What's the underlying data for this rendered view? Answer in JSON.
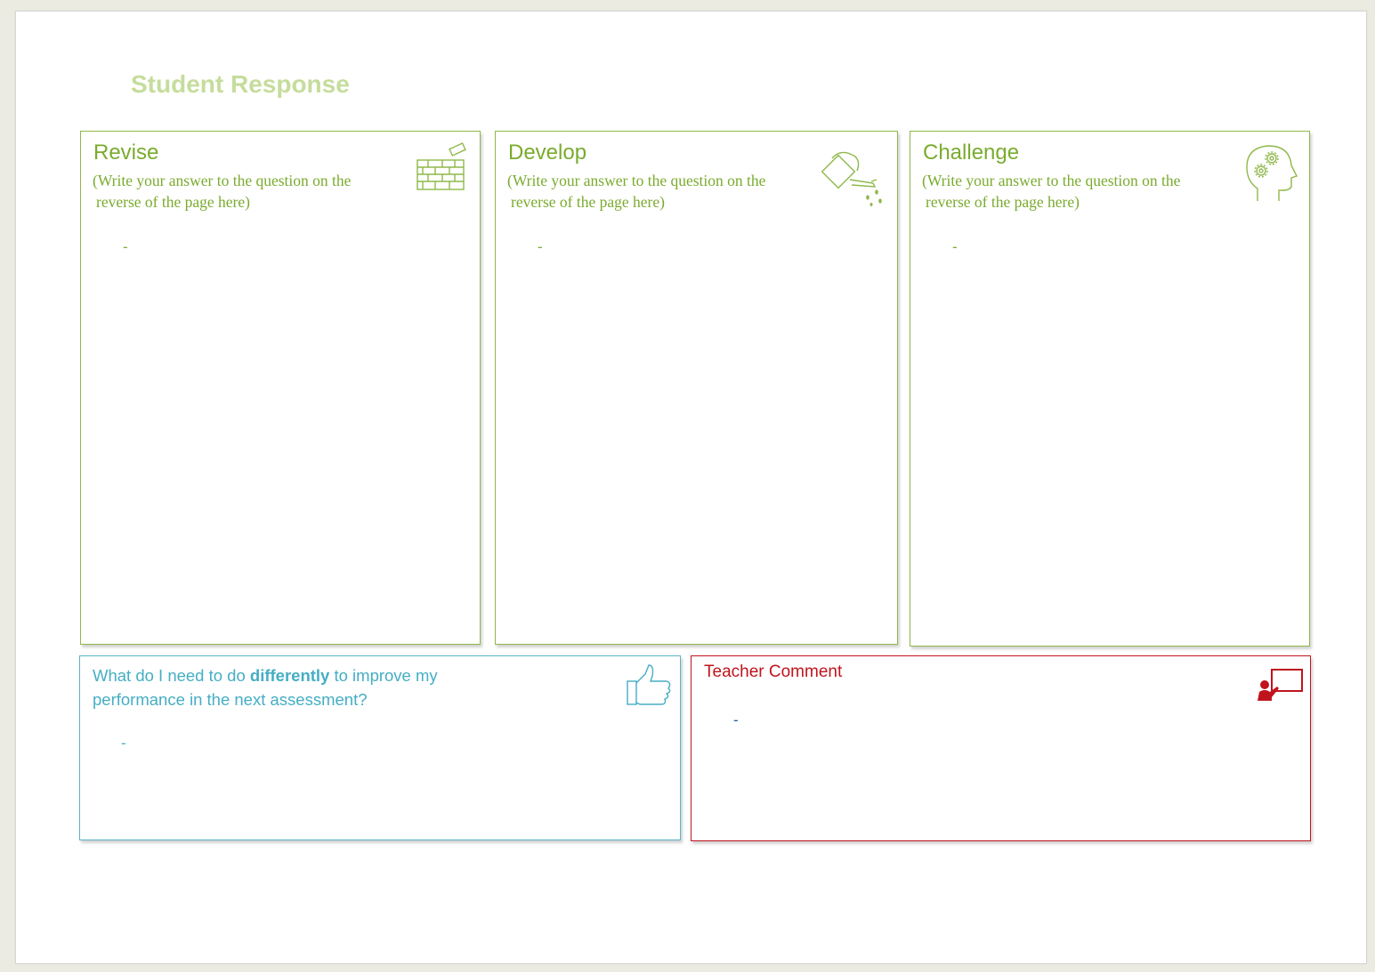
{
  "page_title": "Student Response",
  "cards": [
    {
      "title": "Revise",
      "subtitle_line1": "(Write your answer to the question on the",
      "subtitle_line2": "reverse of the page here)",
      "bullet": "-",
      "icon": "brick-wall-icon",
      "color": "#7aab2e"
    },
    {
      "title": "Develop",
      "subtitle_line1": "(Write your answer to the question on the",
      "subtitle_line2": "reverse of the page here)",
      "bullet": "-",
      "icon": "watering-can-icon",
      "color": "#7aab2e"
    },
    {
      "title": "Challenge",
      "subtitle_line1": "(Write your answer to the question on the",
      "subtitle_line2": "reverse of the page here)",
      "bullet": "-",
      "icon": "head-gears-icon",
      "color": "#7aab2e"
    }
  ],
  "improve": {
    "text_before": "What do I need to do ",
    "text_bold": "differently",
    "text_after": " to improve my",
    "text_line2": "performance in the next assessment?",
    "bullet": "-",
    "icon": "thumbs-up-icon",
    "color": "#45aec4"
  },
  "teacher": {
    "title": "Teacher Comment",
    "bullet": "-",
    "icon": "teacher-presentation-icon",
    "color": "#c0141d"
  }
}
